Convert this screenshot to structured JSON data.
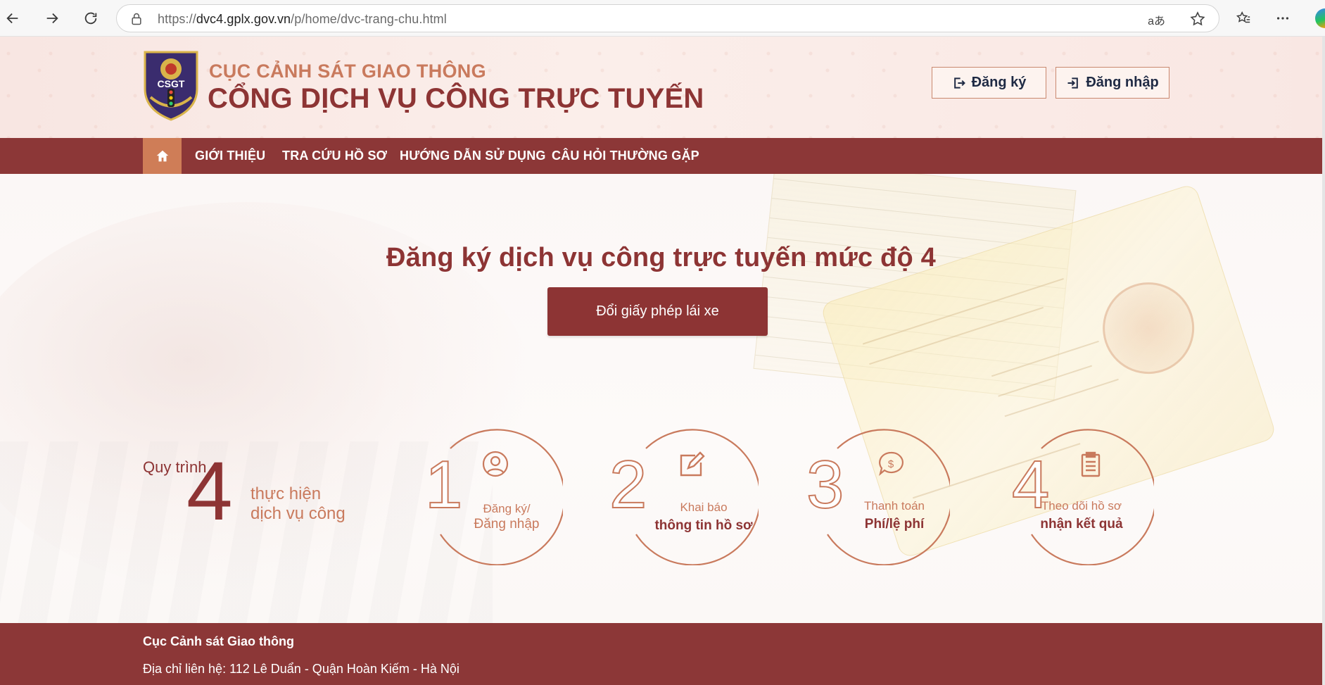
{
  "browser": {
    "url_prefix": "https://",
    "url_domain": "dvc4.gplx.gov.vn",
    "url_path": "/p/home/dvc-trang-chu.html",
    "translate_label": "aあ"
  },
  "header": {
    "subtitle": "CỤC CẢNH SÁT GIAO THÔNG",
    "title": "CỔNG DỊCH VỤ CÔNG TRỰC TUYẾN",
    "logo_text": "CSGT",
    "register_label": "Đăng ký",
    "login_label": "Đăng nhập"
  },
  "nav": {
    "items": [
      {
        "label": "GIỚI THIỆU"
      },
      {
        "label": "TRA CỨU HỒ SƠ"
      },
      {
        "label": "HƯỚNG DẪN SỬ DỤNG"
      },
      {
        "label": "CÂU HỎI THƯỜNG GẶP"
      }
    ]
  },
  "hero": {
    "title": "Đăng ký dịch vụ công trực tuyến mức độ 4",
    "cta_label": "Đổi giấy phép lái xe"
  },
  "process": {
    "label": "Quy trình",
    "count": "4",
    "sub1": "thực hiện",
    "sub2": "dịch vụ công",
    "steps": [
      {
        "num": "1",
        "line1": "Đăng ký/",
        "line2": "Đăng nhập",
        "icon": "user-icon"
      },
      {
        "num": "2",
        "line1": "Khai báo",
        "line2": "thông tin hồ sơ",
        "icon": "edit-icon"
      },
      {
        "num": "3",
        "line1": "Thanh toán",
        "line2": "Phí/lệ phí",
        "icon": "payment-icon"
      },
      {
        "num": "4",
        "line1": "Theo dõi hồ sơ",
        "line2": "nhận kết quả",
        "icon": "clipboard-icon"
      }
    ]
  },
  "footer": {
    "org": "Cục Cảnh sát Giao thông",
    "address": "Địa chỉ liên hệ: 112 Lê Duẩn - Quận Hoàn Kiếm - Hà Nội"
  },
  "colors": {
    "brand": "#8d3434",
    "accent": "#c97a5d",
    "nav_active": "#cf7d57"
  }
}
